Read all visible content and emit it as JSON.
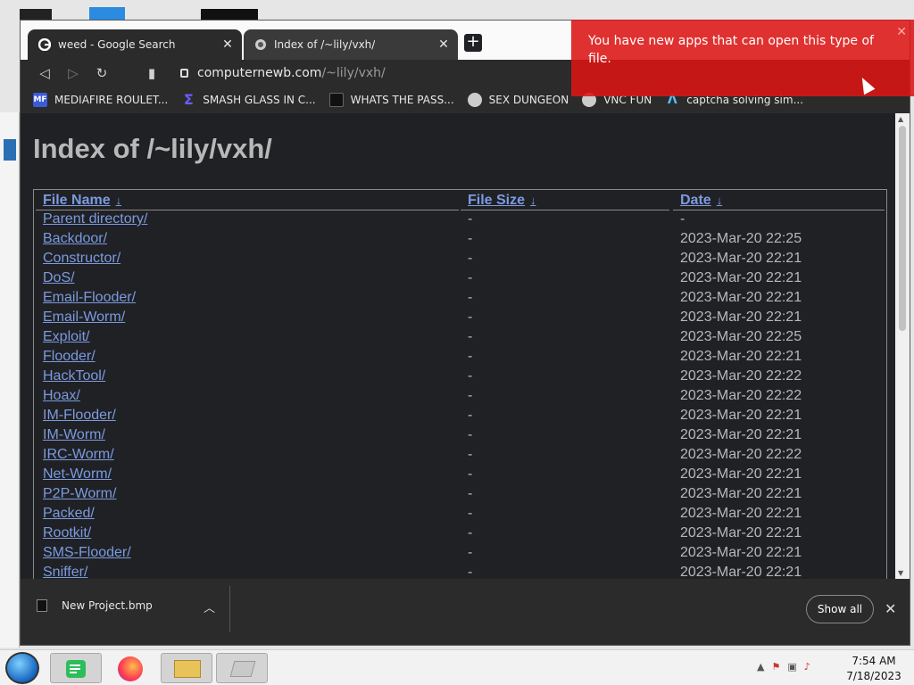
{
  "tabs": [
    {
      "title": "weed - Google Search",
      "icon": "google-icon"
    },
    {
      "title": "Index of /~lily/vxh/",
      "icon": "page-icon"
    }
  ],
  "address": {
    "host": "computernewb.com",
    "path": "/~lily/vxh/"
  },
  "bookmarks": [
    {
      "label": "MEDIAFIRE ROULET...",
      "icon": "mediafire-icon",
      "color": "#3a5bd9"
    },
    {
      "label": "SMASH GLASS IN C...",
      "icon": "sigma-icon",
      "color": "#6a5cff"
    },
    {
      "label": "WHATS THE PASS...",
      "icon": "dark-square-icon",
      "color": "#111111"
    },
    {
      "label": "SEX DUNGEON",
      "icon": "globe-icon",
      "color": "#cccccc"
    },
    {
      "label": "VNC FUN",
      "icon": "globe-icon",
      "color": "#cccccc"
    },
    {
      "label": "captcha solving sim...",
      "icon": "lambda-icon",
      "color": "#4fc3f7"
    }
  ],
  "page": {
    "title": "Index of /~lily/vxh/"
  },
  "listing": {
    "headers": {
      "name": "File Name",
      "size": "File Size",
      "date": "Date",
      "sort_arrow": "↓"
    },
    "rows": [
      {
        "name": "Parent directory/",
        "size": "-",
        "date": "-"
      },
      {
        "name": "Backdoor/",
        "size": "-",
        "date": "2023-Mar-20 22:25"
      },
      {
        "name": "Constructor/",
        "size": "-",
        "date": "2023-Mar-20 22:21"
      },
      {
        "name": "DoS/",
        "size": "-",
        "date": "2023-Mar-20 22:21"
      },
      {
        "name": "Email-Flooder/",
        "size": "-",
        "date": "2023-Mar-20 22:21"
      },
      {
        "name": "Email-Worm/",
        "size": "-",
        "date": "2023-Mar-20 22:21"
      },
      {
        "name": "Exploit/",
        "size": "-",
        "date": "2023-Mar-20 22:25"
      },
      {
        "name": "Flooder/",
        "size": "-",
        "date": "2023-Mar-20 22:21"
      },
      {
        "name": "HackTool/",
        "size": "-",
        "date": "2023-Mar-20 22:22"
      },
      {
        "name": "Hoax/",
        "size": "-",
        "date": "2023-Mar-20 22:22"
      },
      {
        "name": "IM-Flooder/",
        "size": "-",
        "date": "2023-Mar-20 22:21"
      },
      {
        "name": "IM-Worm/",
        "size": "-",
        "date": "2023-Mar-20 22:21"
      },
      {
        "name": "IRC-Worm/",
        "size": "-",
        "date": "2023-Mar-20 22:22"
      },
      {
        "name": "Net-Worm/",
        "size": "-",
        "date": "2023-Mar-20 22:21"
      },
      {
        "name": "P2P-Worm/",
        "size": "-",
        "date": "2023-Mar-20 22:21"
      },
      {
        "name": "Packed/",
        "size": "-",
        "date": "2023-Mar-20 22:21"
      },
      {
        "name": "Rootkit/",
        "size": "-",
        "date": "2023-Mar-20 22:21"
      },
      {
        "name": "SMS-Flooder/",
        "size": "-",
        "date": "2023-Mar-20 22:21"
      },
      {
        "name": "Sniffer/",
        "size": "-",
        "date": "2023-Mar-20 22:21"
      }
    ]
  },
  "download": {
    "filename": "New Project.bmp",
    "show_all": "Show all"
  },
  "toast": {
    "message": "You have new apps that can open this type of file."
  },
  "taskbar": {
    "apps": [
      "notes-icon",
      "firefox-icon",
      "file-explorer-icon",
      "app-icon"
    ],
    "time": "7:54 AM",
    "date": "7/18/2023"
  },
  "colors": {
    "link": "#7b9ae0",
    "text": "#b8b8b8",
    "page_bg": "#202124",
    "toast": "#dc1414"
  }
}
